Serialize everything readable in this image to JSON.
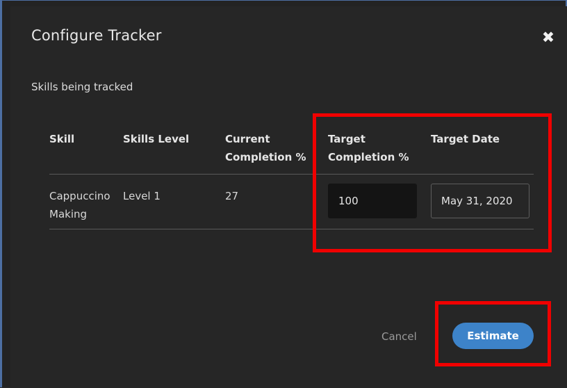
{
  "dialog": {
    "title": "Configure Tracker",
    "close_symbol": "✖",
    "close_icon": "close-icon",
    "subtitle": "Skills being tracked"
  },
  "table": {
    "headers": {
      "skill": "Skill",
      "skills_level": "Skills Level",
      "current_completion": "Current Completion %",
      "target_completion": "Target Completion %",
      "target_date": "Target Date"
    },
    "rows": [
      {
        "skill": "Cappuccino Making",
        "skills_level": "Level 1",
        "current_completion": "27",
        "target_completion": "100",
        "target_date": "May 31, 2020"
      }
    ]
  },
  "actions": {
    "cancel_label": "Cancel",
    "estimate_label": "Estimate"
  },
  "colors": {
    "background": "#262626",
    "primary_button": "#3d83c9",
    "highlight": "#f00000"
  }
}
